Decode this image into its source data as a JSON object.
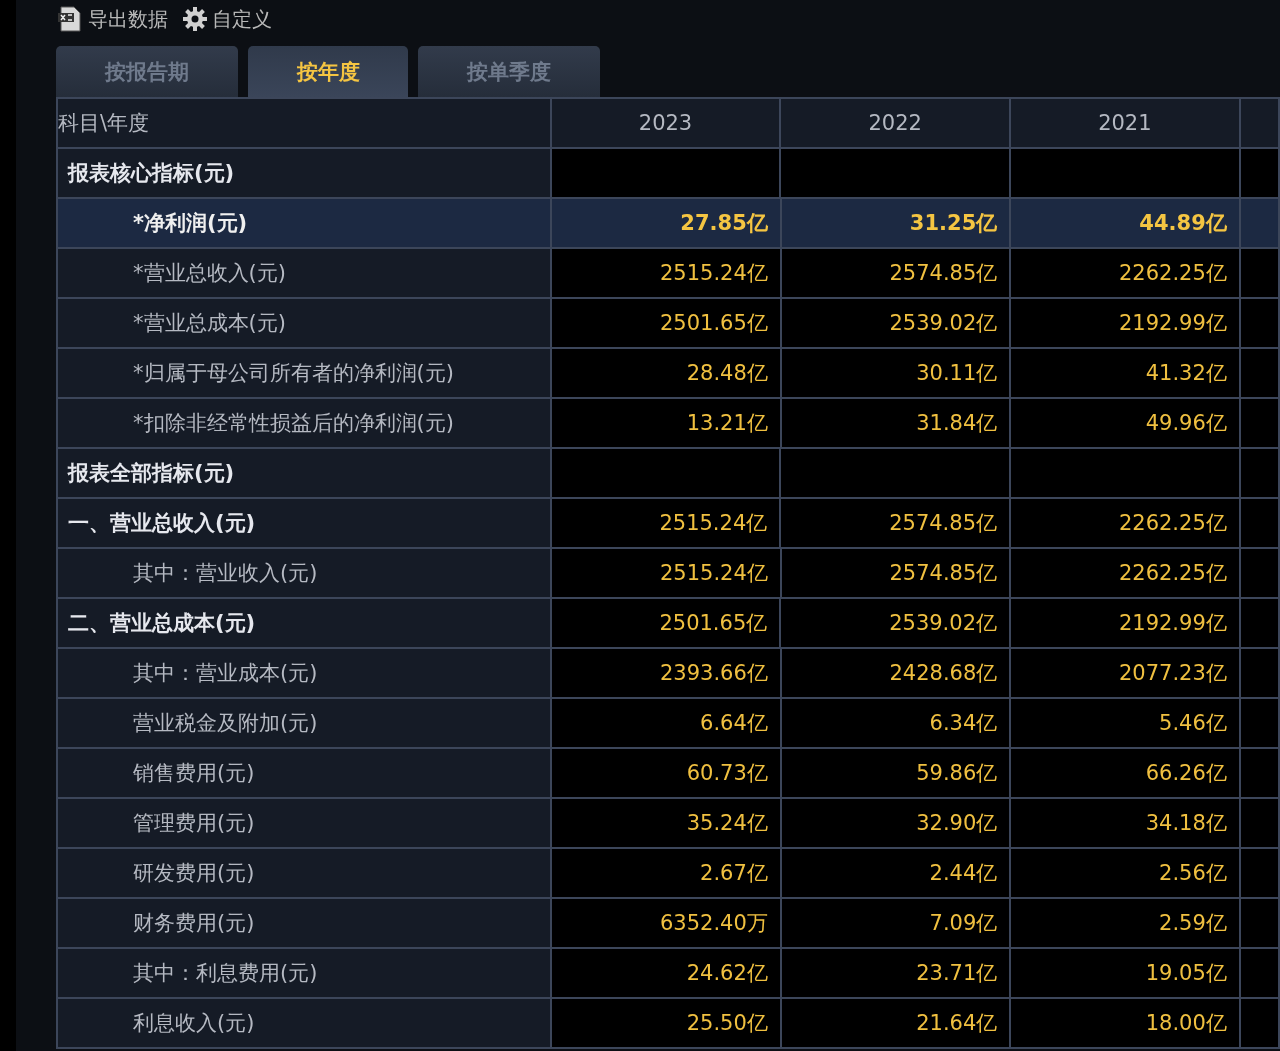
{
  "toolbar": [
    {
      "kind": "export",
      "label": "导出数据"
    },
    {
      "kind": "settings",
      "label": "自定义"
    }
  ],
  "tabs": [
    {
      "label": "按报告期",
      "selected": false
    },
    {
      "label": "按年度",
      "selected": true
    },
    {
      "label": "按单季度",
      "selected": false
    }
  ],
  "table": {
    "columns": [
      "科目\\年度",
      "2023",
      "2022",
      "2021"
    ],
    "rows": [
      {
        "kind": "section",
        "label": "报表核心指标(元)",
        "selected": false,
        "children": [
          {
            "kind": "line",
            "label": "*净利润(元)",
            "selected": true,
            "values": [
              "27.85亿",
              "31.25亿",
              "44.89亿"
            ]
          },
          {
            "kind": "line",
            "label": "*营业总收入(元)",
            "selected": false,
            "values": [
              "2515.24亿",
              "2574.85亿",
              "2262.25亿"
            ]
          },
          {
            "kind": "line",
            "label": "*营业总成本(元)",
            "selected": false,
            "values": [
              "2501.65亿",
              "2539.02亿",
              "2192.99亿"
            ]
          },
          {
            "kind": "line",
            "label": "*归属于母公司所有者的净利润(元)",
            "selected": false,
            "values": [
              "28.48亿",
              "30.11亿",
              "41.32亿"
            ]
          },
          {
            "kind": "line",
            "label": "*扣除非经常性损益后的净利润(元)",
            "selected": false,
            "values": [
              "13.21亿",
              "31.84亿",
              "49.96亿"
            ]
          }
        ]
      },
      {
        "kind": "section",
        "label": "报表全部指标(元)",
        "selected": false
      },
      {
        "kind": "line",
        "label": "一、营业总收入(元)",
        "selected": false,
        "values": [
          "2515.24亿",
          "2574.85亿",
          "2262.25亿"
        ],
        "children": [
          {
            "kind": "line",
            "label": "其中：营业收入(元)",
            "selected": false,
            "values": [
              "2515.24亿",
              "2574.85亿",
              "2262.25亿"
            ]
          }
        ]
      },
      {
        "kind": "line",
        "label": "二、营业总成本(元)",
        "selected": false,
        "values": [
          "2501.65亿",
          "2539.02亿",
          "2192.99亿"
        ],
        "children": [
          {
            "kind": "line",
            "label": "其中：营业成本(元)",
            "selected": false,
            "values": [
              "2393.66亿",
              "2428.68亿",
              "2077.23亿"
            ]
          },
          {
            "kind": "line",
            "label": "营业税金及附加(元)",
            "selected": false,
            "values": [
              "6.64亿",
              "6.34亿",
              "5.46亿"
            ]
          },
          {
            "kind": "line",
            "label": "销售费用(元)",
            "selected": false,
            "values": [
              "60.73亿",
              "59.86亿",
              "66.26亿"
            ]
          },
          {
            "kind": "line",
            "label": "管理费用(元)",
            "selected": false,
            "values": [
              "35.24亿",
              "32.90亿",
              "34.18亿"
            ]
          },
          {
            "kind": "line",
            "label": "研发费用(元)",
            "selected": false,
            "values": [
              "2.67亿",
              "2.44亿",
              "2.56亿"
            ]
          },
          {
            "kind": "line",
            "label": "财务费用(元)",
            "selected": false,
            "values": [
              "6352.40万",
              "7.09亿",
              "2.59亿"
            ]
          },
          {
            "kind": "line",
            "label": "其中：利息费用(元)",
            "selected": false,
            "values": [
              "24.62亿",
              "23.71亿",
              "19.05亿"
            ]
          },
          {
            "kind": "line",
            "label": "利息收入(元)",
            "selected": false,
            "values": [
              "25.50亿",
              "21.64亿",
              "18.00亿"
            ]
          }
        ]
      }
    ]
  }
}
